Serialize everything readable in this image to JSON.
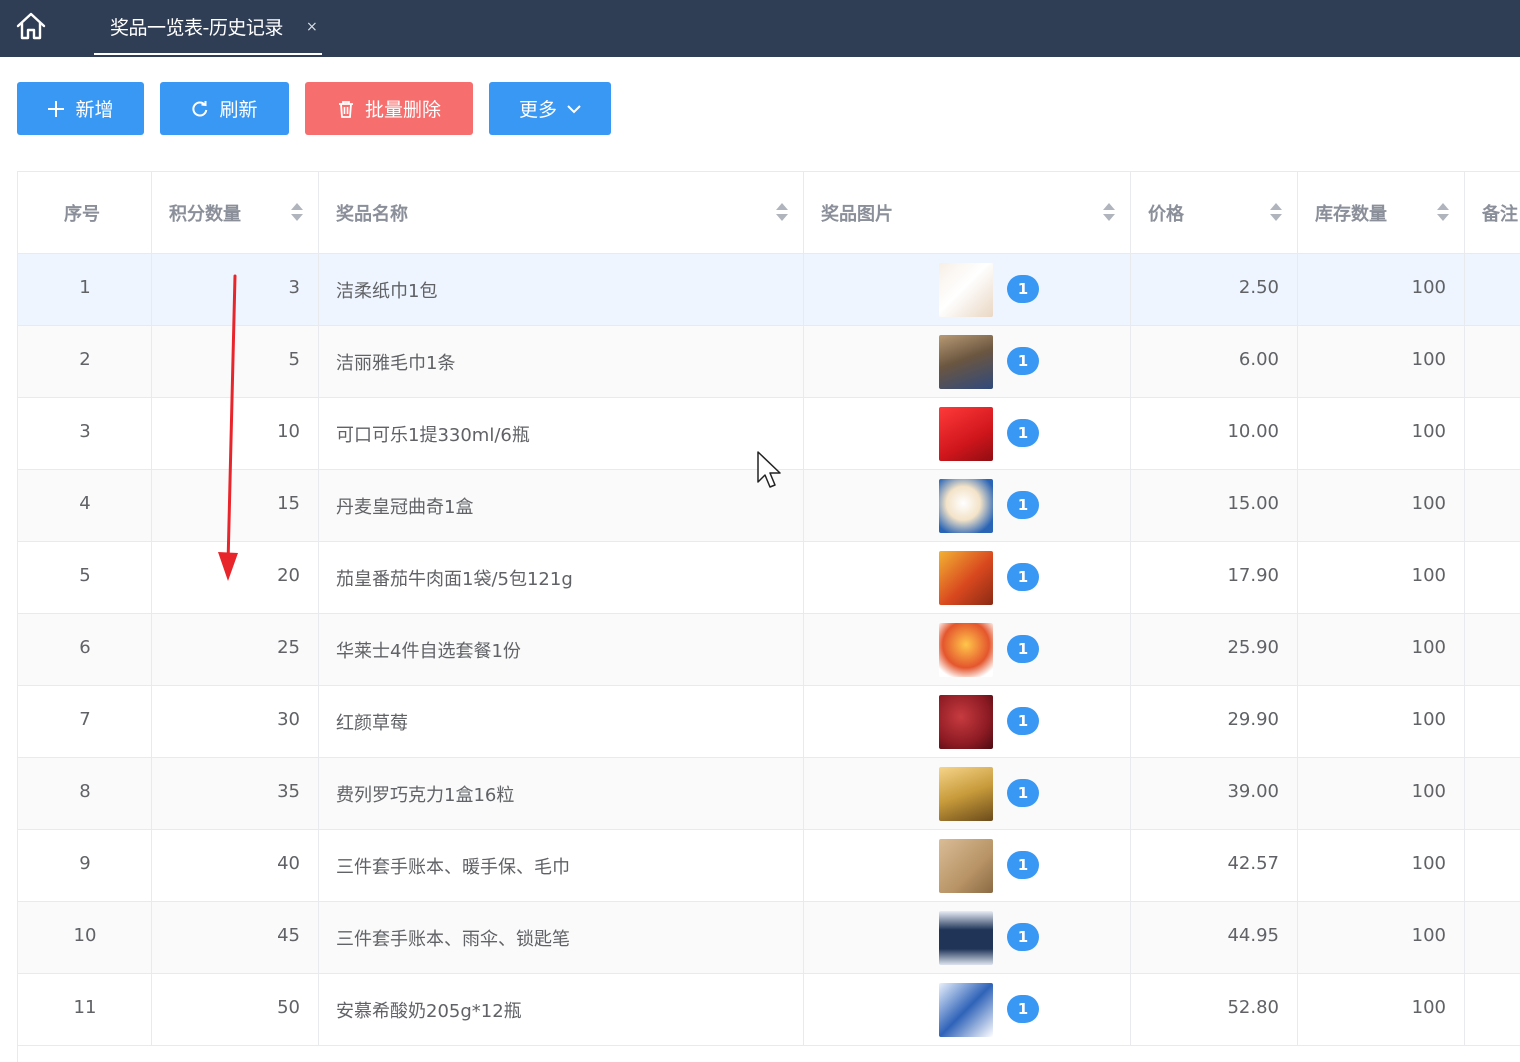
{
  "tab": {
    "label": "奖品一览表-历史记录",
    "close": "×"
  },
  "toolbar": {
    "add": "新增",
    "refresh": "刷新",
    "batch_delete": "批量删除",
    "more": "更多"
  },
  "table": {
    "headers": [
      "序号",
      "积分数量",
      "奖品名称",
      "奖品图片",
      "价格",
      "库存数量",
      "备注"
    ],
    "rows": [
      {
        "no": "1",
        "points": "3",
        "name": "洁柔纸巾1包",
        "img_count": "1",
        "price": "2.50",
        "stock": "100"
      },
      {
        "no": "2",
        "points": "5",
        "name": "洁丽雅毛巾1条",
        "img_count": "1",
        "price": "6.00",
        "stock": "100"
      },
      {
        "no": "3",
        "points": "10",
        "name": "可口可乐1提330ml/6瓶",
        "img_count": "1",
        "price": "10.00",
        "stock": "100"
      },
      {
        "no": "4",
        "points": "15",
        "name": "丹麦皇冠曲奇1盒",
        "img_count": "1",
        "price": "15.00",
        "stock": "100"
      },
      {
        "no": "5",
        "points": "20",
        "name": "茄皇番茄牛肉面1袋/5包121g",
        "img_count": "1",
        "price": "17.90",
        "stock": "100"
      },
      {
        "no": "6",
        "points": "25",
        "name": "华莱士4件自选套餐1份",
        "img_count": "1",
        "price": "25.90",
        "stock": "100"
      },
      {
        "no": "7",
        "points": "30",
        "name": "红颜草莓",
        "img_count": "1",
        "price": "29.90",
        "stock": "100"
      },
      {
        "no": "8",
        "points": "35",
        "name": "费列罗巧克力1盒16粒",
        "img_count": "1",
        "price": "39.00",
        "stock": "100"
      },
      {
        "no": "9",
        "points": "40",
        "name": "三件套手账本、暖手保、毛巾",
        "img_count": "1",
        "price": "42.57",
        "stock": "100"
      },
      {
        "no": "10",
        "points": "45",
        "name": "三件套手账本、雨伞、锁匙笔",
        "img_count": "1",
        "price": "44.95",
        "stock": "100"
      },
      {
        "no": "11",
        "points": "50",
        "name": "安慕希酸奶205g*12瓶",
        "img_count": "1",
        "price": "52.80",
        "stock": "100"
      }
    ]
  },
  "colors": {
    "primary": "#3a98f5",
    "danger": "#f76e6e",
    "topbar": "#2f3e55",
    "arrow": "#e8252b"
  }
}
